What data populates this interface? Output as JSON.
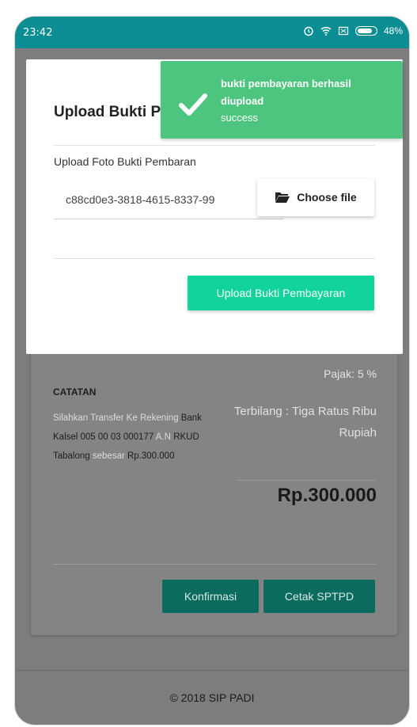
{
  "statusbar": {
    "time": "23:42",
    "battery": "48%"
  },
  "card": {
    "tax": "Pajak: 5 %",
    "catatan_label": "CATATAN",
    "note_part1": "Silahkan Transfer Ke Rekening ",
    "note_bank": "Bank Kalsel 005 00 03 000177",
    "note_part2": " A.N ",
    "note_name": "RKUD Tabalong",
    "note_part3": " sebesar ",
    "note_amount": "Rp.300.000",
    "terbilang": "Terbilang : Tiga Ratus Ribu Rupiah",
    "total": "Rp.300.000",
    "btn_konfirmasi": "Konfirmasi",
    "btn_cetak": "Cetak SPTPD"
  },
  "footer": {
    "text": "© 2018 SIP PADI"
  },
  "modal": {
    "title": "Upload Bukti Pembayaran",
    "close": "×",
    "upload_label": "Upload Foto Bukti Pembaran",
    "file_name": "c88cd0e3-3818-4615-8337-99",
    "choose_file": "Choose file",
    "upload_button": "Upload Bukti Pembayaran"
  },
  "toast": {
    "title": "bukti pembayaran berhasil diupload",
    "subtitle": "success",
    "color": "#4ec57f"
  },
  "colors": {
    "statusbar": "#0b8e93",
    "primary_btn": "#12d49b",
    "dark_btn": "#0b6b5f"
  }
}
